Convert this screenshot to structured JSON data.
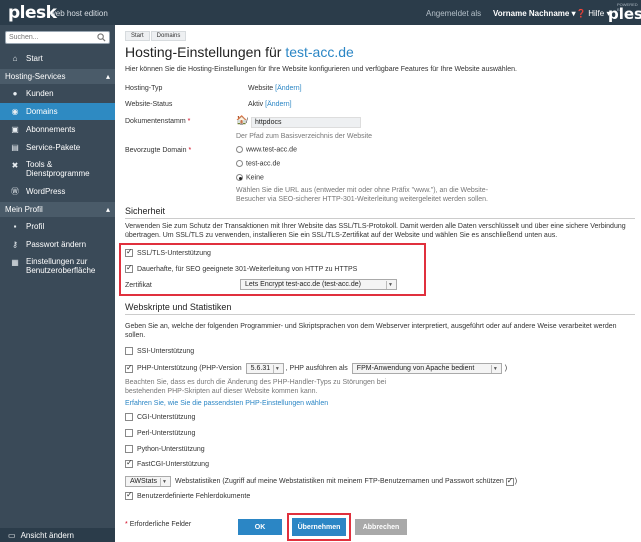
{
  "header": {
    "logo": "plesk",
    "edition": "web host edition",
    "signed_in_as": "Angemeldet als",
    "user_name": "Vorname Nachname",
    "help": "Hilfe",
    "powered": "POWERED BY",
    "logo_right": "plesk"
  },
  "sidebar": {
    "search_placeholder": "Suchen...",
    "start": "Start",
    "section_hosting": "Hosting-Services",
    "items": [
      "Kunden",
      "Domains",
      "Abonnements",
      "Service-Pakete",
      "Tools & Dienstprogramme",
      "WordPress"
    ],
    "section_profile": "Mein Profil",
    "profile_items": [
      "Profil",
      "Passwort ändern",
      "Einstellungen zur Benutzeroberfläche"
    ],
    "footer": "Ansicht ändern"
  },
  "breadcrumb": [
    "Start",
    "Domains"
  ],
  "page": {
    "title_prefix": "Hosting-Einstellungen für",
    "title_domain": "test-acc.de",
    "intro": "Hier können Sie die Hosting-Einstellungen für Ihre Website konfigurieren und verfügbare Features für Ihre Website auswählen."
  },
  "hosting": {
    "type_label": "Hosting-Typ",
    "type_value": "Website",
    "change": "[Ändern]",
    "status_label": "Website-Status",
    "status_value": "Aktiv",
    "docroot_label": "Dokumentenstamm",
    "docroot_slash": "/",
    "docroot_value": "httpdocs",
    "docroot_hint": "Der Pfad zum Basisverzeichnis der Website",
    "domain_label": "Bevorzugte Domain",
    "domain_options": [
      "www.test-acc.de",
      "test-acc.de",
      "Keine"
    ],
    "domain_selected": "Keine",
    "domain_hint_1": "Wählen Sie die URL aus (entweder mit oder ohne Präfix \"www.\"), an die Website-",
    "domain_hint_2": "Besucher via SEO-sicherer HTTP-301-Weiterleitung weitergeleitet werden sollen."
  },
  "security": {
    "heading": "Sicherheit",
    "desc_1": "Verwenden Sie zum Schutz der Transaktionen mit Ihrer Website das SSL/TLS-Protokoll. Damit werden alle Daten verschlüsselt und über eine sichere Verbindung",
    "desc_2": "übertragen. Um SSL/TLS zu verwenden, installieren Sie ein SSL/TLS-Zertifikat auf der Website und wählen Sie es anschließend unten aus.",
    "ssl_label": "SSL/TLS-Unterstützung",
    "ssl_checked": true,
    "redirect_label": "Dauerhafte, für SEO geeignete 301-Weiterleitung von HTTP zu HTTPS",
    "redirect_checked": true,
    "cert_label": "Zertifikat",
    "cert_value": "Lets Encrypt test-acc.de (test-acc.de)"
  },
  "scripting": {
    "heading": "Webskripte und Statistiken",
    "desc_1": "Geben Sie an, welche der folgenden Programmier- und Skriptsprachen von dem Webserver interpretiert, ausgeführt oder auf andere Weise verarbeitet werden",
    "desc_2": "sollen.",
    "ssi": "SSI-Unterstützung",
    "php_prefix": "PHP-Unterstützung (PHP-Version",
    "php_version": "5.6.31",
    "php_run_as": ", PHP ausführen als",
    "php_handler": "FPM-Anwendung von Apache bedient",
    "php_suffix": ")",
    "php_hint_1": "Beachten Sie, dass es durch die Änderung des PHP-Handler-Typs zu Störungen bei",
    "php_hint_2": "bestehenden PHP-Skripten auf dieser Website kommen kann.",
    "php_link": "Erfahren Sie, wie Sie die passendsten PHP-Einstellungen wählen",
    "cgi": "CGI-Unterstützung",
    "perl": "Perl-Unterstützung",
    "python": "Python-Unterstützung",
    "fastcgi": "FastCGI-Unterstützung",
    "stats_tool": "AWStats",
    "stats_label": "Webstatistiken (Zugriff auf meine Webstatistiken mit meinem FTP-Benutzernamen und Passwort schützen",
    "stats_suffix": ")",
    "custom_errors": "Benutzerdefinierte Fehlerdokumente"
  },
  "footer": {
    "required_star": "*",
    "required": "Erforderliche Felder",
    "ok": "OK",
    "apply": "Übernehmen",
    "cancel": "Abbrechen"
  },
  "colors": {
    "topbar": "#2b3c4a",
    "sidebar": "#3a4a58",
    "active": "#2e8ac2",
    "link": "#2b86c5",
    "highlight": "#e0303d"
  }
}
